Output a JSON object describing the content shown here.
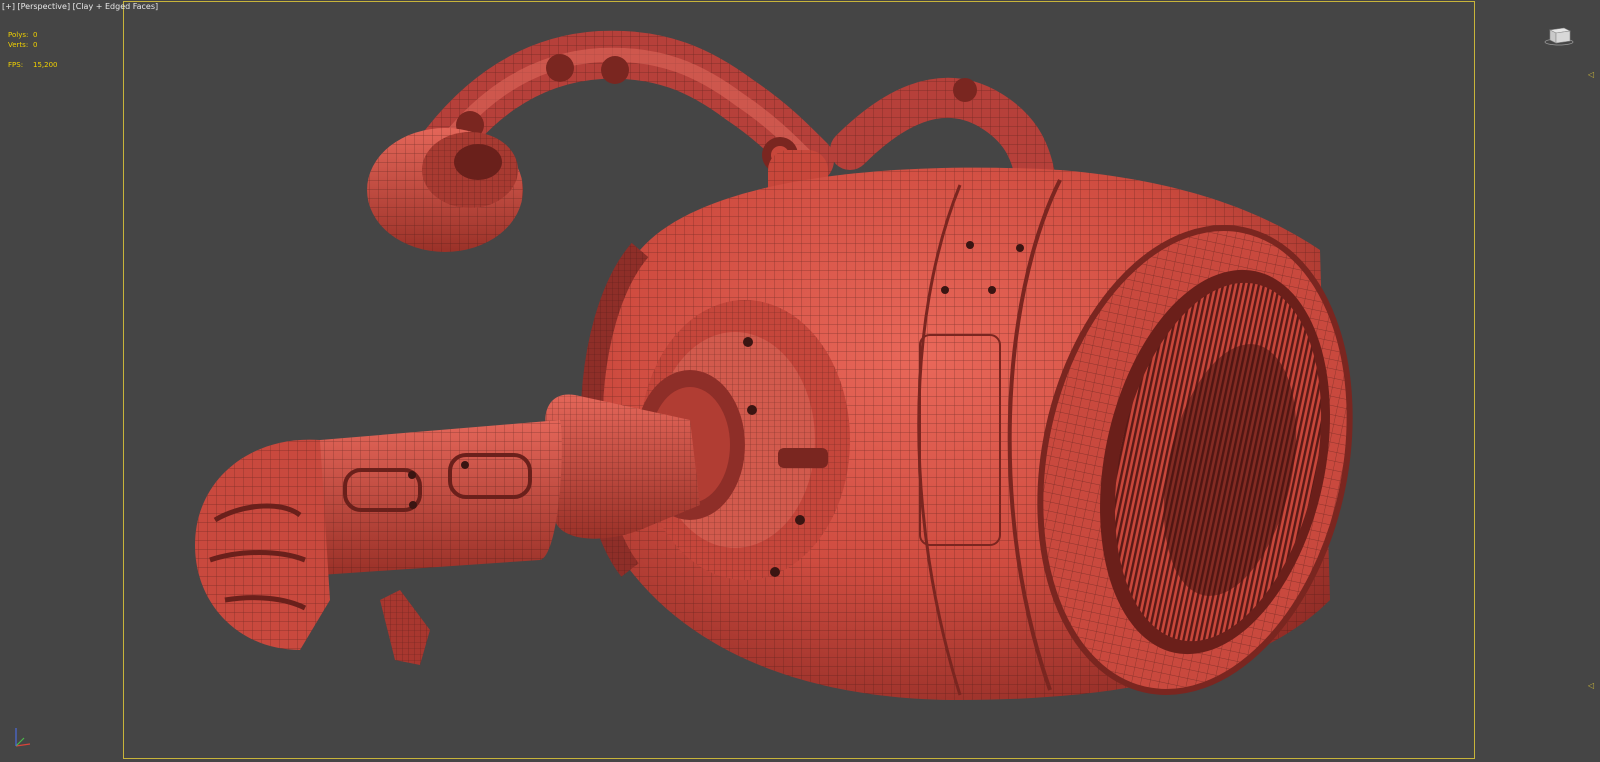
{
  "viewport": {
    "label_parts": [
      "[+]",
      "[Perspective]",
      "[Clay + Edged Faces]"
    ],
    "stats": {
      "polys_label": "Polys:",
      "polys_value": "0",
      "verts_label": "Verts:",
      "verts_value": "0",
      "fps_label": "FPS:",
      "fps_value": "15,200"
    }
  },
  "colors": {
    "background": "#454545",
    "active_border": "#c8b43a",
    "stats_text": "#f2d200",
    "clay": "#d9574a",
    "clay_shadow": "#8e2e28",
    "wire": "#3a1512"
  },
  "icons": {
    "viewcube": "viewcube-icon",
    "axis": "axis-tripod-icon",
    "nav_arrows": "triangle-left-icon"
  }
}
